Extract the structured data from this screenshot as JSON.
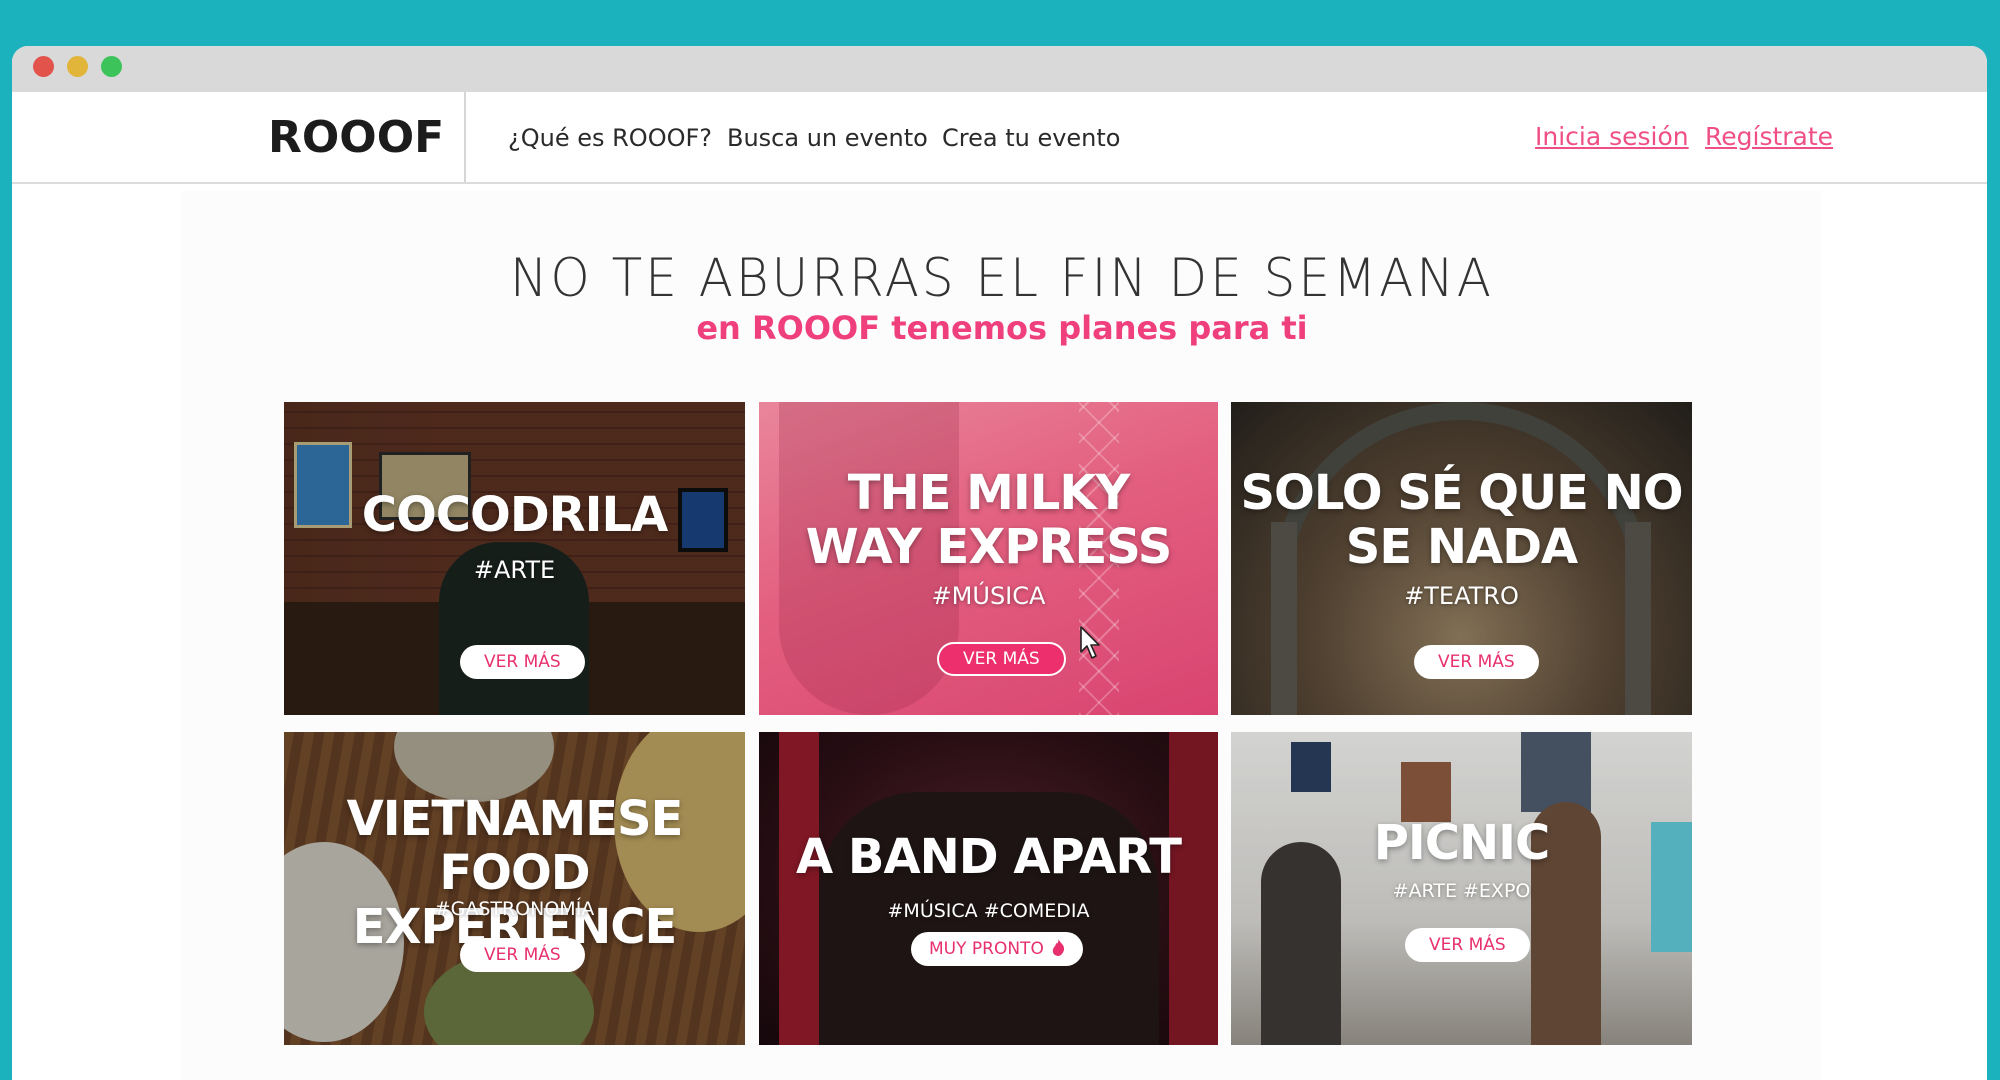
{
  "nav": {
    "logo": "ROOOF",
    "links": [
      "¿Qué es ROOOF?",
      "Busca un evento",
      "Crea tu evento"
    ],
    "login": "Inicia sesión",
    "register": "Regístrate"
  },
  "hero": {
    "headline": "NO TE ABURRAS EL FIN DE SEMANA",
    "subhead": "en ROOOF tenemos planes para ti"
  },
  "cards": [
    {
      "title": "COCODRILA",
      "tag": "#ARTE",
      "button": "VER MÁS"
    },
    {
      "title": "THE MILKY\nWAY EXPRESS",
      "tag": "#MÚSICA",
      "button": "VER MÁS"
    },
    {
      "title": "SOLO SÉ QUE NO\nSE NADA",
      "tag": "#TEATRO",
      "button": "VER MÁS"
    },
    {
      "title": "VIETNAMESE\nFOOD EXPERIENCE",
      "tag": "#GASTRONOMÍA",
      "button": "VER MÁS"
    },
    {
      "title": "A BAND APART",
      "tag": "#MÚSICA #COMEDIA",
      "button": "MUY PRONTO"
    },
    {
      "title": "PICNIC",
      "tag": "#ARTE  #EXPO",
      "button": "VER MÁS"
    }
  ],
  "colors": {
    "accent": "#ef3f7d",
    "background": "#1bb1bd"
  }
}
